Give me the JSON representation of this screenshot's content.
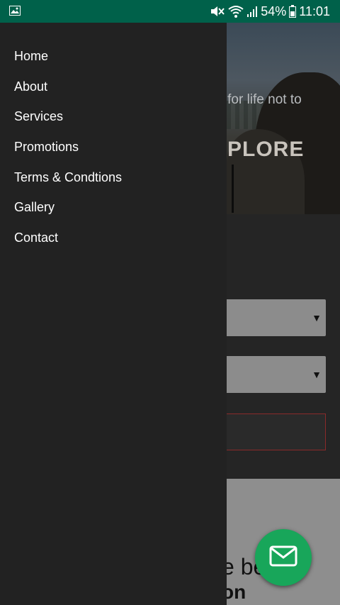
{
  "status_bar": {
    "battery": "54%",
    "time": "11:01",
    "icons": [
      "image-icon",
      "mute-icon",
      "wifi-icon",
      "signal-icon",
      "battery-icon"
    ]
  },
  "drawer": {
    "items": [
      {
        "label": "Home"
      },
      {
        "label": "About"
      },
      {
        "label": "Services"
      },
      {
        "label": "Promotions"
      },
      {
        "label": "Terms & Condtions"
      },
      {
        "label": "Gallery"
      },
      {
        "label": "Contact"
      }
    ]
  },
  "hero": {
    "tagline": "ut for life not to",
    "title": "XPLORE"
  },
  "form": {
    "select1_arrow": "▼",
    "select2_arrow": "▼"
  },
  "section": {
    "text1": "e be    ts",
    "text2": "on"
  },
  "fab": {
    "icon": "mail-icon"
  },
  "colors": {
    "status_bar": "#00614a",
    "drawer_bg": "#222222",
    "fab": "#18a65a"
  }
}
